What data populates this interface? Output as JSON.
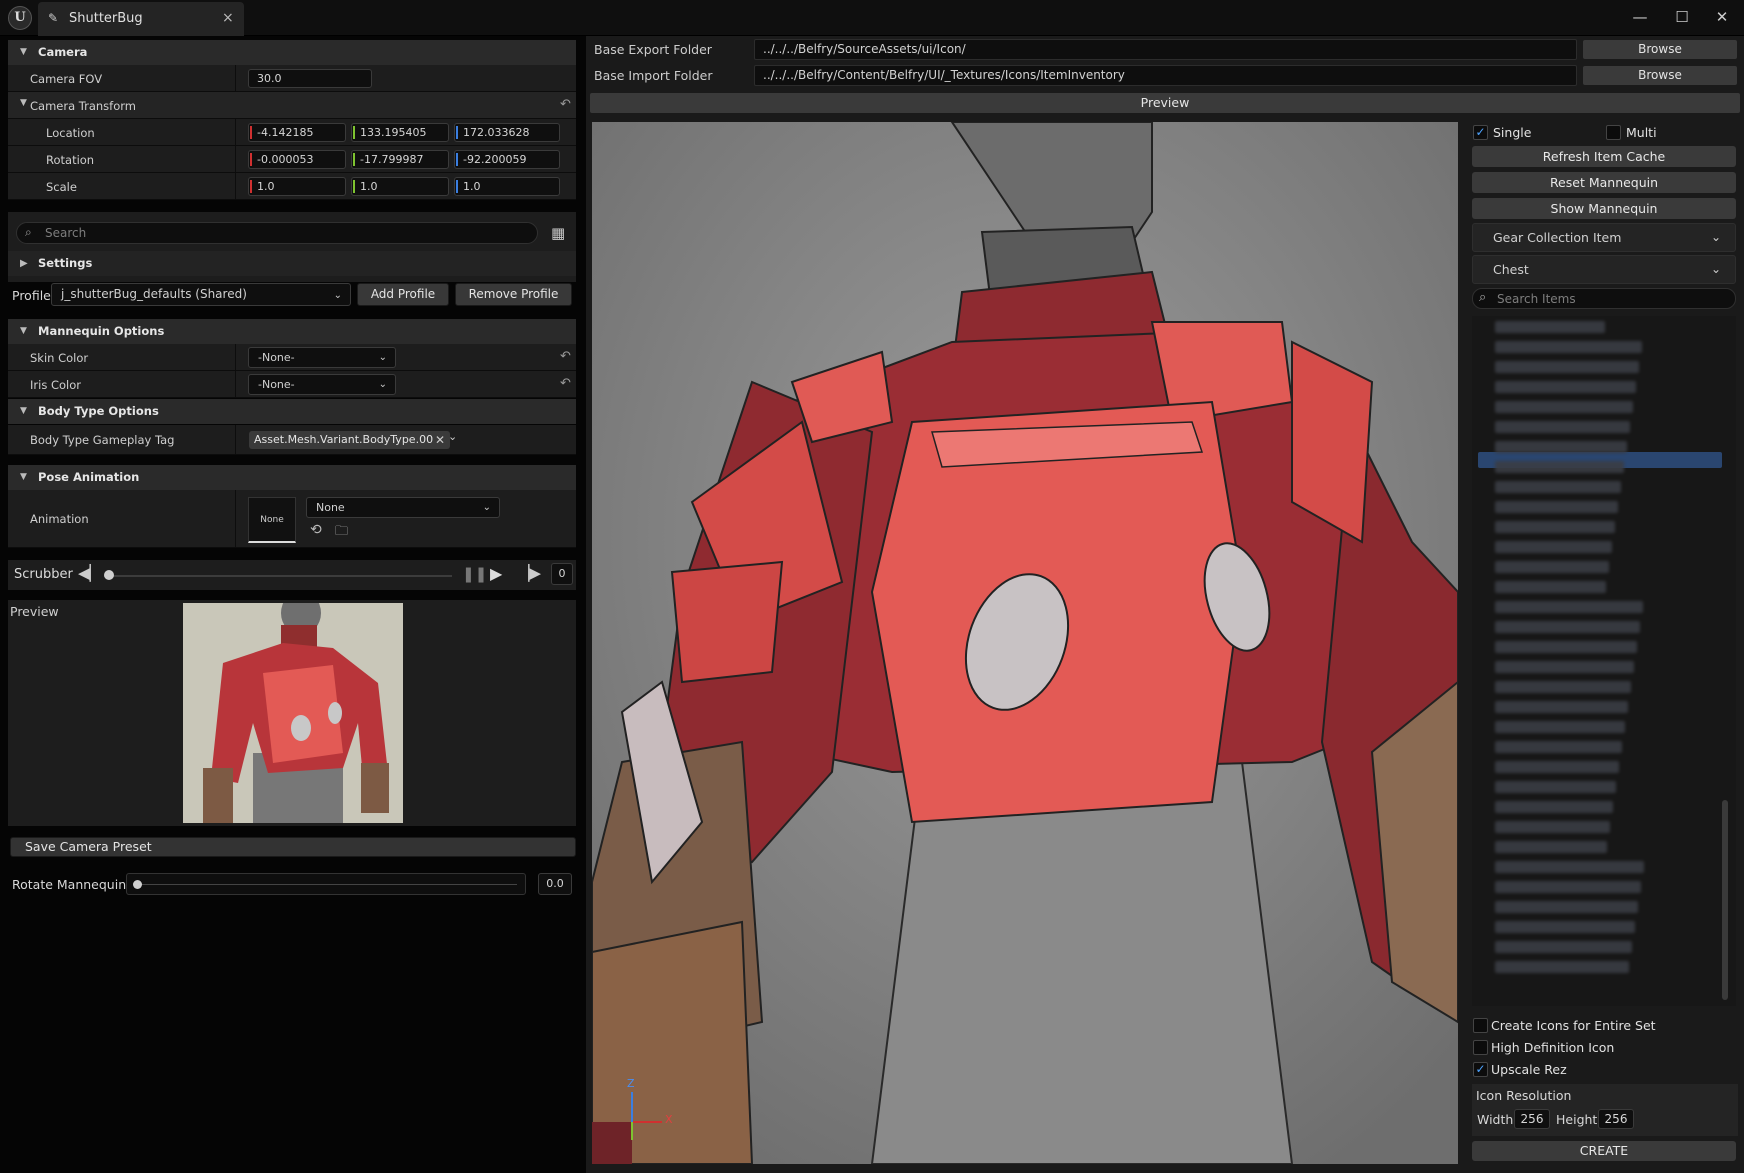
{
  "window": {
    "logo_text": "U",
    "tab_title": "ShutterBug",
    "minimize": "—",
    "maximize": "☐",
    "close": "✕",
    "tab_close": "×"
  },
  "camera": {
    "header": "Camera",
    "fov_label": "Camera FOV",
    "fov_value": "30.0",
    "transform_header": "Camera Transform",
    "location_label": "Location",
    "location": [
      "-4.142185",
      "133.195405",
      "172.033628"
    ],
    "rotation_label": "Rotation",
    "rotation": [
      "-0.000053",
      "-17.799987",
      "-92.200059"
    ],
    "scale_label": "Scale",
    "scale": [
      "1.0",
      "1.0",
      "1.0"
    ]
  },
  "search": {
    "placeholder": "Search"
  },
  "settings": {
    "header": "Settings"
  },
  "profile": {
    "label": "Profile",
    "value": "j_shutterBug_defaults (Shared)",
    "add": "Add Profile",
    "remove": "Remove Profile"
  },
  "mannequin_options": {
    "header": "Mannequin Options",
    "skin_label": "Skin Color",
    "skin_value": "-None-",
    "iris_label": "Iris Color",
    "iris_value": "-None-"
  },
  "body_type": {
    "header": "Body Type Options",
    "tag_label": "Body Type Gameplay Tag",
    "tag_value": "Asset.Mesh.Variant.BodyType.00"
  },
  "pose": {
    "header": "Pose Animation",
    "anim_label": "Animation",
    "thumb_text": "None",
    "anim_value": "None"
  },
  "scrubber": {
    "label": "Scrubber",
    "frame": "0",
    "position": 0
  },
  "preview_small": {
    "label": "Preview"
  },
  "save_preset": "Save Camera Preset",
  "rotate": {
    "label": "Rotate Mannequin",
    "value": "0.0",
    "position": 0
  },
  "folders": {
    "export_label": "Base Export Folder",
    "export_path": "../../../Belfry/SourceAssets/ui/Icon/",
    "import_label": "Base Import Folder",
    "import_path": "../../../Belfry/Content/Belfry/UI/_Textures/Icons/ItemInventory",
    "browse": "Browse"
  },
  "preview_header": "Preview",
  "viewport_axes": {
    "x": "X",
    "z": "Z"
  },
  "side": {
    "single": "Single",
    "multi": "Multi",
    "refresh": "Refresh Item Cache",
    "reset": "Reset Mannequin",
    "show": "Show Mannequin",
    "collection": "Gear Collection Item",
    "slot": "Chest",
    "search_placeholder": "Search Items",
    "create_set": "Create Icons for Entire Set",
    "hd_icon": "High Definition Icon",
    "upscale": "Upscale Rez",
    "res_header": "Icon Resolution",
    "width_label": "Width",
    "width_value": "256",
    "height_label": "Height",
    "height_value": "256",
    "create": "CREATE"
  },
  "colors": {
    "accent": "#4da3ff",
    "axis_x": "#d03030",
    "axis_y": "#7ec330",
    "axis_z": "#3a7ee0",
    "armor": "#e35a55"
  }
}
